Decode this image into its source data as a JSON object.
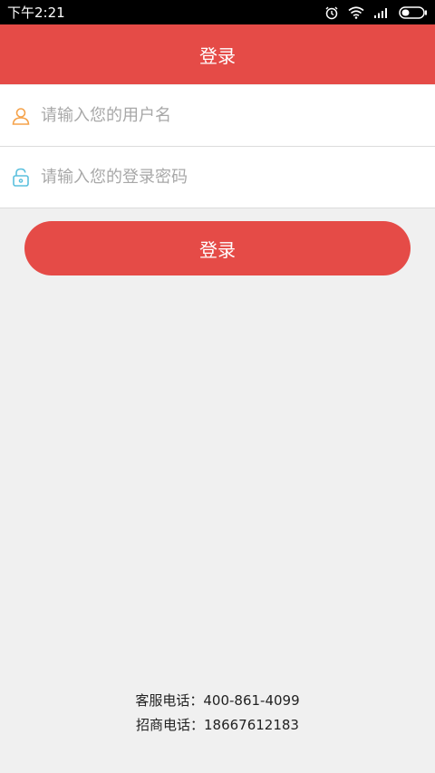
{
  "status_bar": {
    "time": "下午2:21",
    "icons": [
      "alarm-icon",
      "wifi-icon",
      "signal-icon",
      "battery-icon"
    ]
  },
  "header": {
    "title": "登录"
  },
  "form": {
    "username_placeholder": "请输入您的用户名",
    "password_placeholder": "请输入您的登录密码",
    "username_value": "",
    "password_value": "",
    "login_label": "登录"
  },
  "footer": {
    "service_phone": "客服电话：400-861-4099",
    "business_phone": "招商电话：18667612183"
  },
  "colors": {
    "accent": "#e54b47",
    "user_icon": "#f5a24a",
    "lock_icon": "#5bc0de",
    "background": "#f0f0f0"
  }
}
